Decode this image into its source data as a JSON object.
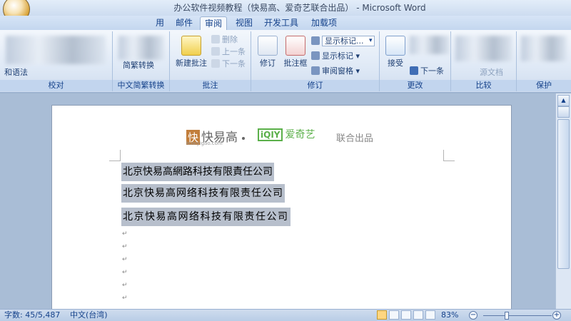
{
  "window": {
    "title": "办公软件视频教程（快易高、爱奇艺联合出品） - Microsoft Word"
  },
  "tabs": [
    {
      "label": "用"
    },
    {
      "label": "邮件"
    },
    {
      "label": "审阅"
    },
    {
      "label": "视图"
    },
    {
      "label": "开发工具"
    },
    {
      "label": "加载项"
    }
  ],
  "ribbon": {
    "proofing": {
      "label": "校对",
      "grammar": "和语法"
    },
    "chinese": {
      "label": "中文简繁转换",
      "convert": "简繁转换"
    },
    "comments": {
      "label": "批注",
      "new_comment": "新建批注",
      "delete": "删除",
      "previous": "上一条",
      "next": "下一条"
    },
    "tracking": {
      "label": "修订",
      "track": "修订",
      "balloons": "批注框",
      "show_markup_value": "显示标记...",
      "show_markup": "显示标记",
      "review_pane": "审阅窗格"
    },
    "changes": {
      "label": "更改",
      "accept": "接受",
      "next": "下一条"
    },
    "compare": {
      "label": "比较",
      "source_doc": "源文档"
    },
    "protect": {
      "label": "保护"
    }
  },
  "document": {
    "logo_kuai": "快易高",
    "logo_kuai_box": "快",
    "logo_kuai_sub": "kuaiyigao.com",
    "logo_iqiyi_box": "iQIY",
    "logo_iqiyi": "爱奇艺",
    "logo_joint": "联合出品",
    "lines": [
      "北京快易高網路科技有限責任公司",
      "北京快易高网络科技有限责任公司",
      "北京快易高网络科技有限责任公司"
    ],
    "paragraph_mark": "↵"
  },
  "status": {
    "word_count": "字数: 45/5,487",
    "language": "中文(台湾)",
    "zoom": "83%"
  },
  "colors": {
    "ribbon_bg": "#dfe9f6",
    "selection": "#b7bfcc",
    "accent_text": "#15428b"
  }
}
